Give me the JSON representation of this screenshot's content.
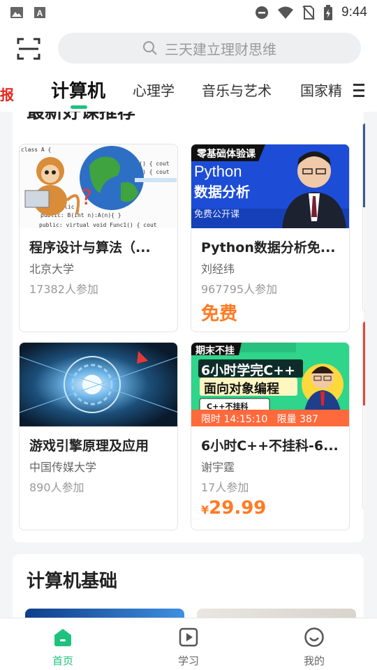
{
  "status_bar": {
    "time": "9:44"
  },
  "search": {
    "placeholder": "三天建立理财思维"
  },
  "tabs": {
    "badge": "报",
    "items": [
      "计算机",
      "心理学",
      "音乐与艺术",
      "国家精"
    ]
  },
  "section1": {
    "title": "最新好课推荐",
    "cards": [
      {
        "title": "程序设计与算法（...",
        "school": "北京大学",
        "count": "17382人参加",
        "price": ""
      },
      {
        "title": "Python数据分析免...",
        "school": "刘经纬",
        "count": "967795人参加",
        "price": "免费",
        "thumb_badge": "零基础体验课",
        "thumb_main": "Python",
        "thumb_sub": "数据分析",
        "thumb_note": "免费公开课"
      },
      {
        "title": "游戏引擎原理及应用",
        "school": "中国传媒大学",
        "count": "890人参加",
        "price": ""
      },
      {
        "title": "6小时C++不挂科-6...",
        "school": "谢宇霆",
        "count": "17人参加",
        "price_symbol": "¥",
        "price": "29.99",
        "thumb_badge": "期末不挂",
        "thumb_main": "6小时学完C++",
        "thumb_sub": "面向对象编程",
        "thumb_tag": "C++不挂科",
        "limit_text": "限时 14:15:10   限量 387"
      }
    ]
  },
  "section2": {
    "title": "计算机基础"
  },
  "bottom_nav": {
    "items": [
      "首页",
      "学习",
      "我的"
    ]
  },
  "colors": {
    "accent": "#1fc27d",
    "price": "#ff7a24",
    "badge_red": "#e8271d"
  }
}
